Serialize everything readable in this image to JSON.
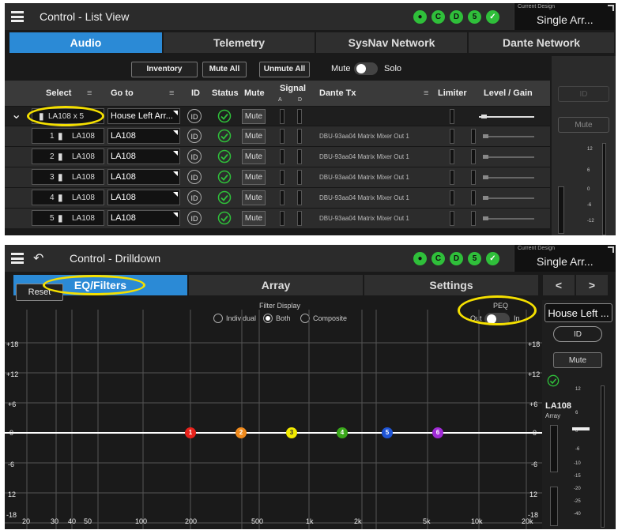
{
  "list_view": {
    "title": "Control - List View",
    "status_icons": [
      "wifi-icon",
      "C",
      "D",
      "5",
      "check-icon"
    ],
    "current_design_label": "Current Design",
    "current_design_value": "Single Arr...",
    "tabs": [
      "Audio",
      "Telemetry",
      "SysNav Network",
      "Dante Network"
    ],
    "active_tab": 0,
    "toolbar": {
      "inventory": "Inventory",
      "mute_all": "Mute All",
      "unmute_all": "Unmute All",
      "mute": "Mute",
      "solo": "Solo"
    },
    "columns": {
      "select": "Select",
      "goto": "Go to",
      "id": "ID",
      "status": "Status",
      "mute": "Mute",
      "signal": "Signal",
      "signal_a": "A",
      "signal_d": "D",
      "dante_tx": "Dante Tx",
      "limiter": "Limiter",
      "level": "Level / Gain"
    },
    "master_row": {
      "select": "LA108 x 5",
      "goto": "House Left Arr...",
      "id": "ID",
      "mute": "Mute"
    },
    "rows": [
      {
        "num": "1",
        "select": "LA108",
        "goto": "LA108",
        "id": "ID",
        "mute": "Mute",
        "dante": "DBU-93aa04 Matrix Mixer Out 1"
      },
      {
        "num": "2",
        "select": "LA108",
        "goto": "LA108",
        "id": "ID",
        "mute": "Mute",
        "dante": "DBU-93aa04 Matrix Mixer Out 1"
      },
      {
        "num": "3",
        "select": "LA108",
        "goto": "LA108",
        "id": "ID",
        "mute": "Mute",
        "dante": "DBU-93aa04 Matrix Mixer Out 1"
      },
      {
        "num": "4",
        "select": "LA108",
        "goto": "LA108",
        "id": "ID",
        "mute": "Mute",
        "dante": "DBU-93aa04 Matrix Mixer Out 1"
      },
      {
        "num": "5",
        "select": "LA108",
        "goto": "LA108",
        "id": "ID",
        "mute": "Mute",
        "dante": "DBU-93aa04 Matrix Mixer Out 1"
      }
    ],
    "right": {
      "id": "ID",
      "mute": "Mute",
      "scale": [
        "12",
        "6",
        "0",
        "-6",
        "-12"
      ]
    }
  },
  "drilldown": {
    "title": "Control - Drilldown",
    "current_design_label": "Current Design",
    "current_design_value": "Single Arr...",
    "tabs": [
      "EQ/Filters",
      "Array",
      "Settings"
    ],
    "nav_prev": "<",
    "nav_next": ">",
    "reset": "Reset",
    "filter_display": {
      "label": "Filter Display",
      "options": [
        "Individual",
        "Both",
        "Composite"
      ],
      "selected": "Both"
    },
    "peq": {
      "label": "PEQ",
      "out": "Out",
      "in": "In",
      "state": "Out"
    },
    "y_labels": [
      "+18",
      "+12",
      "+6",
      "0",
      "-6",
      "12",
      "-18"
    ],
    "x_labels": [
      "20",
      "30",
      "40",
      "50",
      "100",
      "200",
      "500",
      "1k",
      "2k",
      "5k",
      "10k",
      "20k"
    ],
    "points": [
      {
        "label": "1",
        "color": "#e8231c"
      },
      {
        "label": "2",
        "color": "#f08a1c"
      },
      {
        "label": "3",
        "color": "#f2ea00"
      },
      {
        "label": "4",
        "color": "#3aa81a"
      },
      {
        "label": "5",
        "color": "#1f55d6"
      },
      {
        "label": "6",
        "color": "#a02ad6"
      }
    ],
    "right": {
      "device": "House Left ...",
      "id": "ID",
      "mute": "Mute",
      "model": "LA108",
      "type": "Array",
      "scale": [
        "12",
        "6",
        "0",
        "-6",
        "-10",
        "-15",
        "-20",
        "-25",
        "-40"
      ]
    }
  }
}
